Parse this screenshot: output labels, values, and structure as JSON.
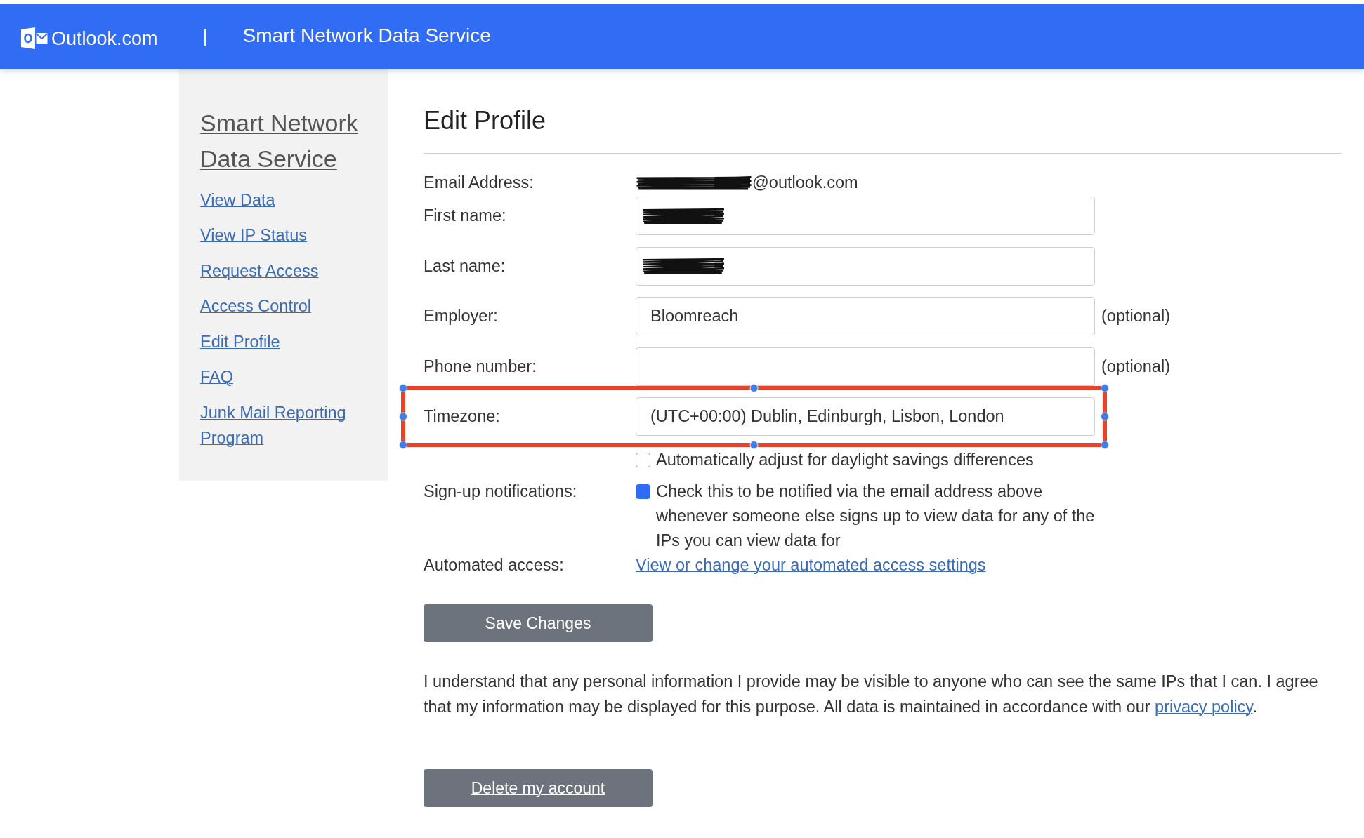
{
  "header": {
    "brand": "Outlook.com",
    "title": "Smart Network Data Service"
  },
  "sidebar": {
    "title": "Smart Network Data Service",
    "items": [
      "View Data",
      "View IP Status",
      "Request Access",
      "Access Control",
      "Edit Profile",
      "FAQ",
      "Junk Mail Reporting Program"
    ]
  },
  "heading": "Edit Profile",
  "form": {
    "rows": [
      {
        "kind": "static",
        "label": "Email Address:",
        "value": "@outlook.com",
        "redacted": true
      },
      {
        "kind": "input",
        "label": "First name:",
        "redacted": true
      },
      {
        "kind": "input",
        "label": "Last name:",
        "redacted": true
      },
      {
        "kind": "input",
        "label": "Employer:",
        "value": "Bloomreach",
        "note": "(optional)"
      },
      {
        "kind": "input",
        "label": "Phone number:",
        "note": "(optional)"
      },
      {
        "kind": "input",
        "label": "Timezone:",
        "value": "(UTC+00:00) Dublin, Edinburgh, Lisbon, London",
        "highlighted": true
      },
      {
        "kind": "checkbox",
        "text": "Automatically adjust for daylight savings differences",
        "checked": false
      },
      {
        "kind": "checkbox",
        "label": "Sign-up notifications:",
        "text": "Check this to be notified via the email address above whenever someone else signs up to view data for any of the IPs you can view data for",
        "checked": true
      },
      {
        "kind": "link",
        "label": "Automated access:",
        "text": "View or change your automated access settings"
      }
    ]
  },
  "save_button": "Save Changes",
  "consent": {
    "text": "I understand that any personal information I provide may be visible to anyone who can see the same IPs that I can. I agree that my information may be displayed for this purpose. All data is maintained in accordance with our",
    "link": "privacy policy",
    "after": "."
  },
  "delete_button": "Delete my account"
}
